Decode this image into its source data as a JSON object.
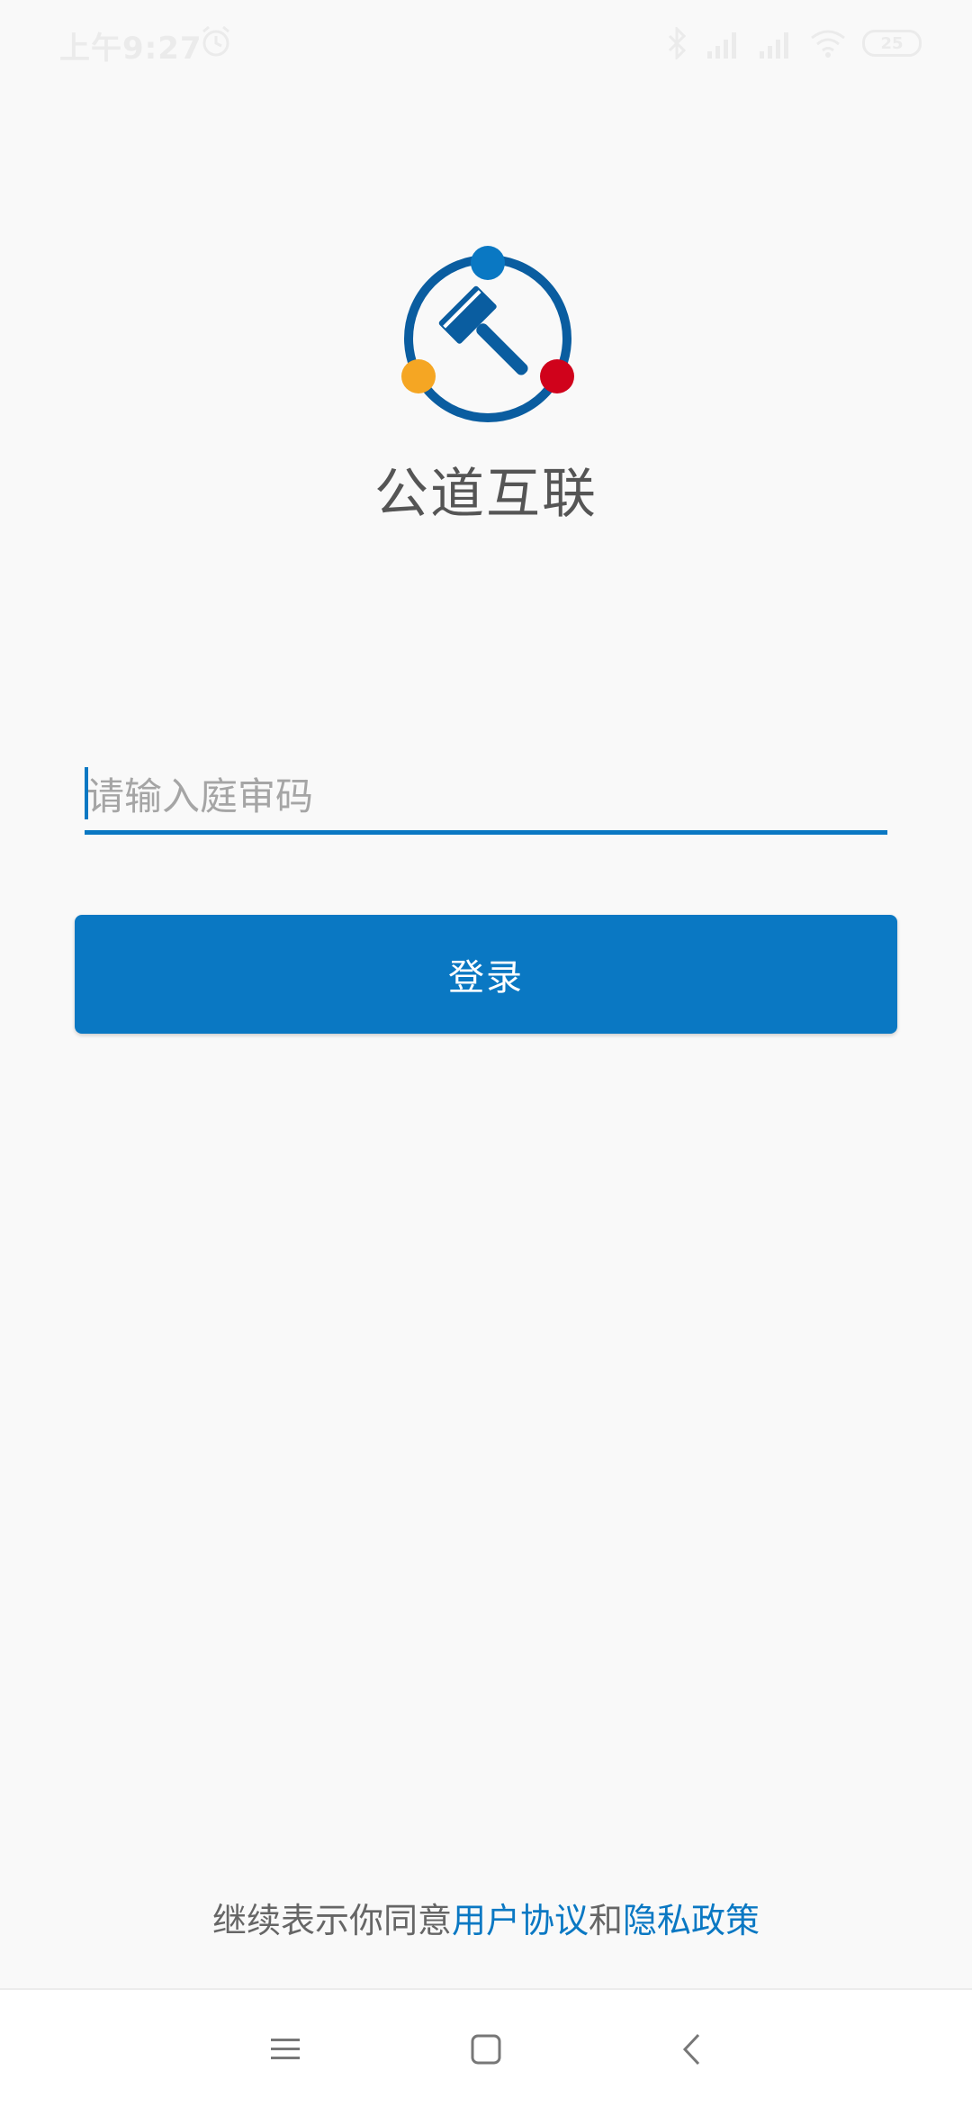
{
  "status_bar": {
    "time": "上午9:27",
    "battery": "25",
    "icons": [
      "alarm-icon",
      "bluetooth-icon",
      "signal-icon",
      "signal-icon",
      "wifi-icon",
      "battery-icon"
    ]
  },
  "app": {
    "name": "公道互联",
    "logo": "gavel-logo",
    "colors": {
      "primary": "#0a78c3",
      "ring": "#0a5da0",
      "dot_top": "#0a78c3",
      "dot_left": "#f5a623",
      "dot_right": "#d0021b"
    }
  },
  "form": {
    "code_placeholder": "请输入庭审码",
    "code_value": "",
    "login_label": "登录"
  },
  "agreement": {
    "prefix": "继续表示你同意",
    "user_agreement": "用户协议",
    "conjunction": "和",
    "privacy_policy": "隐私政策"
  },
  "nav_bar": {
    "buttons": [
      "menu-icon",
      "home-icon",
      "back-icon"
    ]
  }
}
